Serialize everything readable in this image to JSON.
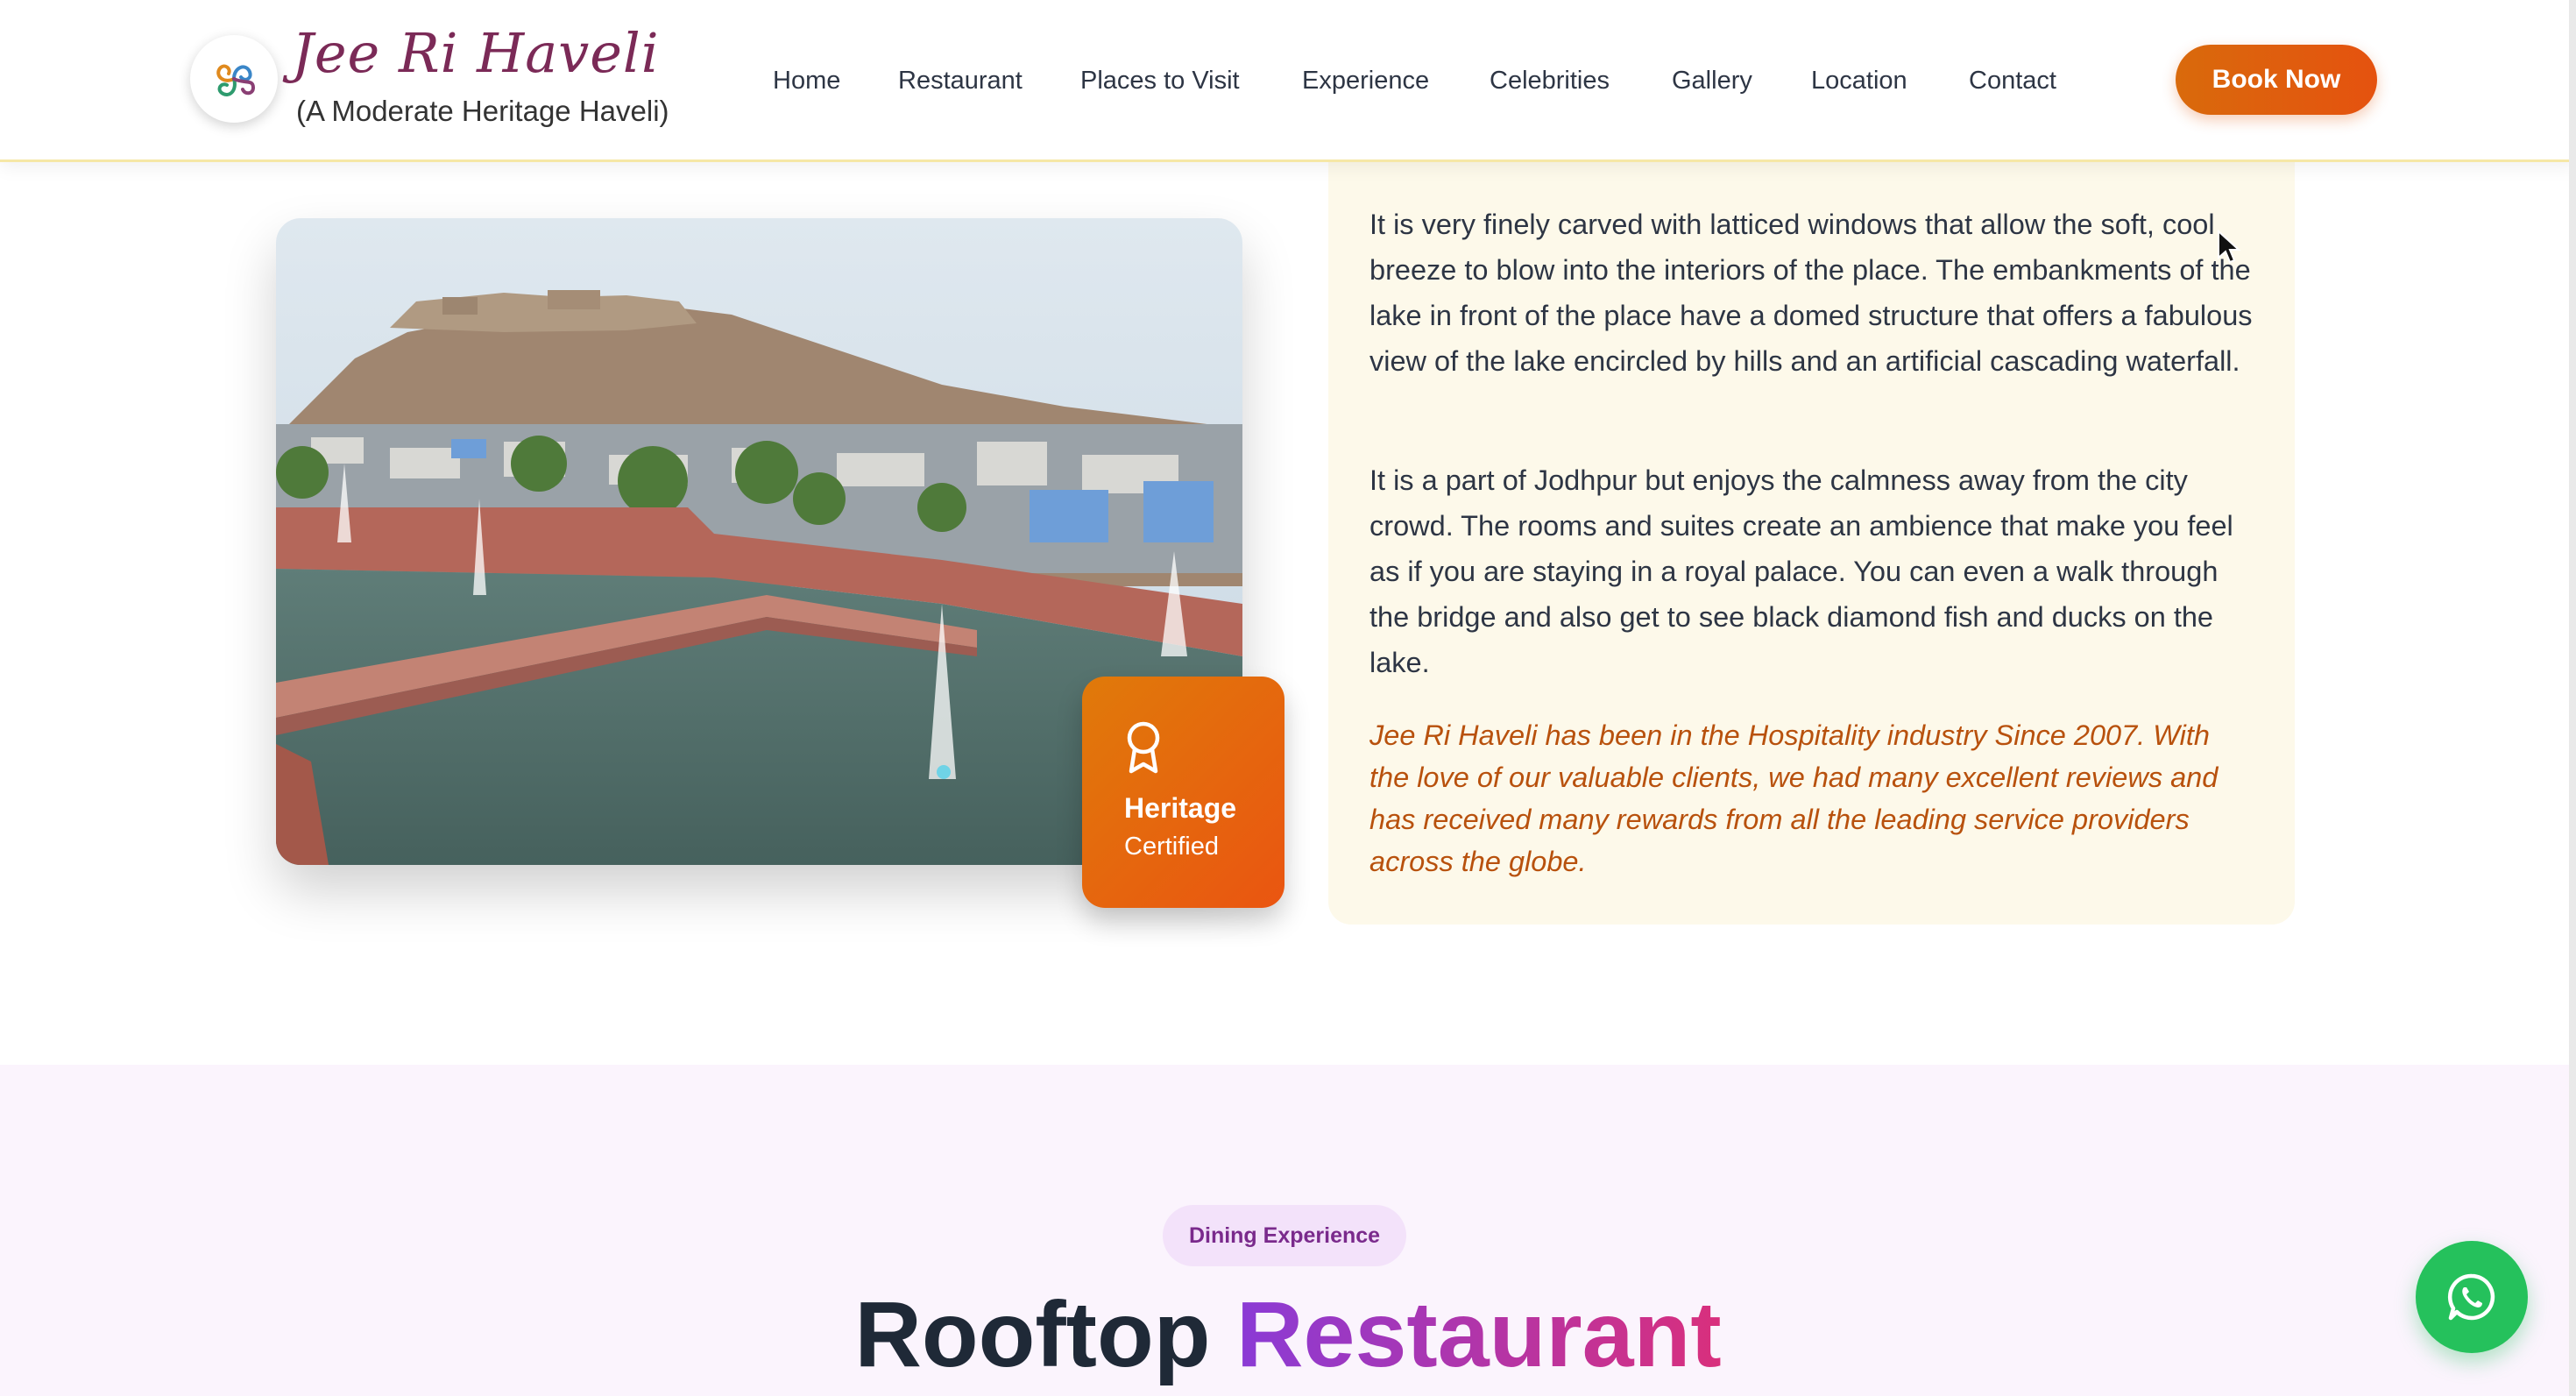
{
  "header": {
    "logo_title": "Jee Ri Haveli",
    "logo_subtitle": "(A Moderate Heritage Haveli)",
    "logo_icon": "triskelion-logo-icon",
    "nav": [
      {
        "label": "Home"
      },
      {
        "label": "Restaurant"
      },
      {
        "label": "Places to Visit"
      },
      {
        "label": "Experience"
      },
      {
        "label": "Celebrities"
      },
      {
        "label": "Gallery"
      },
      {
        "label": "Location"
      },
      {
        "label": "Contact"
      }
    ],
    "book_label": "Book Now",
    "accent_color": "#e5620e"
  },
  "about": {
    "photo": "lake-and-fort-photo",
    "badge": {
      "icon": "award-ribbon-icon",
      "title": "Heritage",
      "subtitle": "Certified"
    },
    "paragraph_1": "It is very finely carved with latticed windows that allow the soft, cool breeze to blow into the interiors of the place. The embankments of the lake in front of the place have a domed structure that offers a fabulous view of the lake encircled by hills and an artificial cascading waterfall.",
    "paragraph_2": "It is a part of Jodhpur but enjoys the calmness away from the city crowd. The rooms and suites create an ambience that make you feel as if you are staying in a royal palace. You can even a walk through the bridge and also get to see black diamond fish and ducks on the lake.",
    "highlight": "Jee Ri Haveli has been in the Hospitality industry Since 2007. With the love of our valuable clients, we had many excellent reviews and has received many rewards from all the leading service providers across the globe."
  },
  "dining": {
    "pill_label": "Dining Experience",
    "heading_part_1": "Rooftop",
    "heading_part_2": "Restaurant"
  },
  "floating": {
    "whatsapp_icon": "whatsapp-icon",
    "whatsapp_color": "#25c15c"
  }
}
